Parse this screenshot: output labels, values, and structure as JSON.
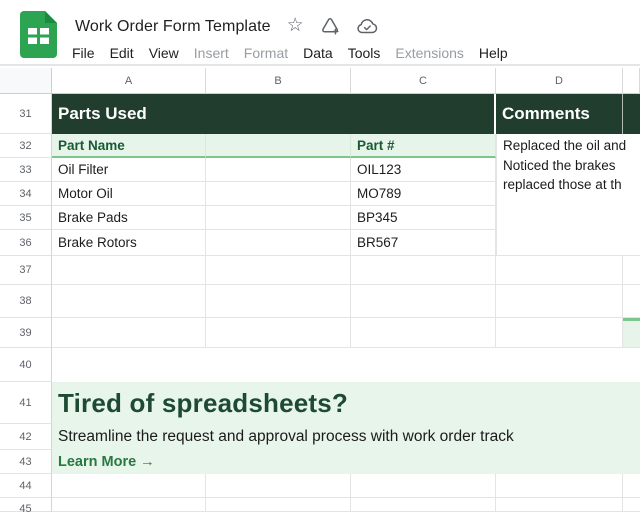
{
  "header": {
    "doc_title": "Work Order Form Template",
    "menu": {
      "file": "File",
      "edit": "Edit",
      "view": "View",
      "insert": "Insert",
      "format": "Format",
      "data": "Data",
      "tools": "Tools",
      "extensions": "Extensions",
      "help": "Help"
    }
  },
  "grid": {
    "column_headers": {
      "a": "A",
      "b": "B",
      "c": "C",
      "d": "D"
    },
    "row_numbers": {
      "r31": "31",
      "r32": "32",
      "r33": "33",
      "r34": "34",
      "r35": "35",
      "r36": "36",
      "r37": "37",
      "r38": "38",
      "r39": "39",
      "r40": "40",
      "r41": "41",
      "r42": "42",
      "r43": "43",
      "r44": "44",
      "r45": "45"
    }
  },
  "sections": {
    "parts_used": {
      "title": "Parts Used",
      "col1_header": "Part Name",
      "col2_header": "Part #",
      "rows": [
        {
          "name": "Oil Filter",
          "part": "OIL123"
        },
        {
          "name": "Motor Oil",
          "part": "MO789"
        },
        {
          "name": "Brake Pads",
          "part": "BP345"
        },
        {
          "name": "Brake Rotors",
          "part": "BR567"
        }
      ]
    },
    "comments": {
      "title": "Comments",
      "text": "Replaced the oil and\nNoticed the brakes\nreplaced those at th"
    },
    "promo": {
      "heading": "Tired of spreadsheets?",
      "body": "Streamline the request and approval process with work order track",
      "cta": "Learn More →"
    }
  },
  "colors": {
    "sheets_green": "#2ca452",
    "section_header_bg": "#203d2e",
    "subheader_bg": "#e6f4ea",
    "subheader_text": "#185b33",
    "accent_border_green": "#7cc68c",
    "banner_bg": "#e8f5eb",
    "promo_heading_green": "#1e4a34",
    "link_green": "#26793f"
  }
}
